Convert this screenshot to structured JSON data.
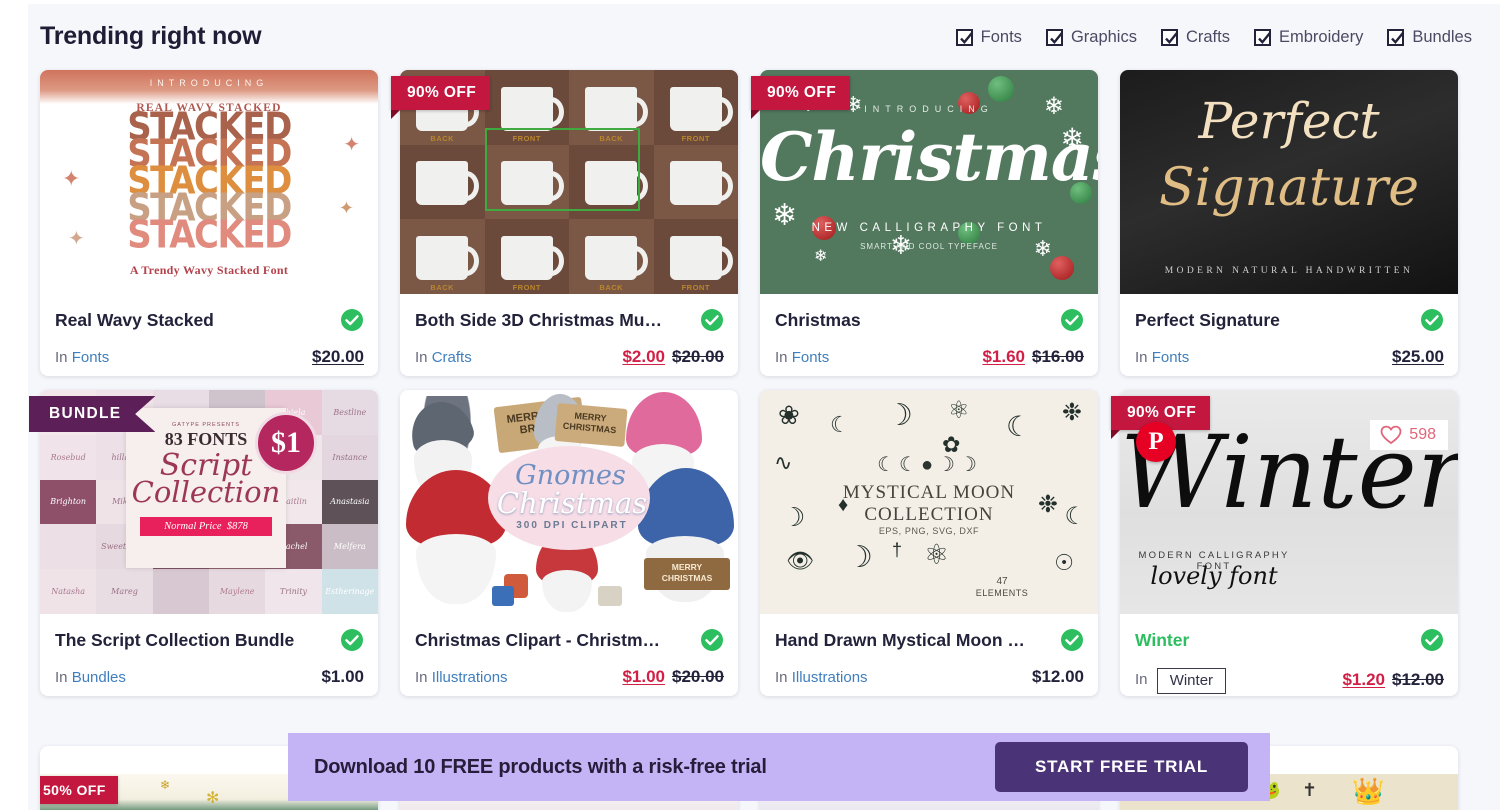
{
  "header": {
    "title": "Trending right now",
    "filters": [
      {
        "label": "Fonts",
        "checked": true
      },
      {
        "label": "Graphics",
        "checked": true
      },
      {
        "label": "Crafts",
        "checked": true
      },
      {
        "label": "Embroidery",
        "checked": true
      },
      {
        "label": "Bundles",
        "checked": true
      }
    ]
  },
  "colors": {
    "discount_badge": "#c3173f",
    "bundle_badge": "#5c1f57",
    "verified_green": "#2dbe60",
    "sale_price_red": "#d21f45",
    "category_link": "#3f7fbf",
    "banner_bg": "#c5b4f5",
    "banner_button": "#4b3377",
    "pinterest_red": "#e60023",
    "like_pink": "#e0657a"
  },
  "products": [
    {
      "title": "Real Wavy Stacked",
      "category_prefix": "In",
      "category": "Fonts",
      "price": "$20.00",
      "old_price": "",
      "badge": "",
      "verified": true,
      "art": {
        "intro": "INTRODUCING",
        "name": "REAL WAVY STACKED",
        "word": "STACKED",
        "tagline": "A Trendy Wavy Stacked Font"
      }
    },
    {
      "title": "Both Side 3D Christmas Mu…",
      "category_prefix": "In",
      "category": "Crafts",
      "price": "$2.00",
      "old_price": "$20.00",
      "badge": "90% OFF",
      "verified": true,
      "art": {
        "labels": [
          "BACK",
          "FRONT",
          "BACK",
          "FRONT",
          "BACK",
          "FRONT",
          "BACK",
          "FRONT"
        ]
      }
    },
    {
      "title": "Christmas",
      "category_prefix": "In",
      "category": "Fonts",
      "price": "$1.60",
      "old_price": "$16.00",
      "badge": "90% OFF",
      "verified": true,
      "art": {
        "intro": "INTRODUCING",
        "word": "Christmas",
        "sub": "NEW CALLIGRAPHY FONT",
        "sub2": "SMART AND COOL TYPEFACE"
      }
    },
    {
      "title": "Perfect Signature",
      "category_prefix": "In",
      "category": "Fonts",
      "price": "$25.00",
      "old_price": "",
      "badge": "",
      "verified": true,
      "art": {
        "line1": "Perfect",
        "line2": "Signature",
        "sub": "MODERN NATURAL HANDWRITTEN"
      }
    },
    {
      "title": "The Script Collection Bundle",
      "category_prefix": "In",
      "category": "Bundles",
      "price": "$1.00",
      "old_price": "",
      "badge": "BUNDLE",
      "verified": true,
      "art": {
        "presents": "GATYPE PRESENTS",
        "count": "83 FONTS",
        "line1": "Script",
        "line2": "Collection",
        "normal_label": "Normal Price",
        "normal_price": "$878",
        "dollar": "$1"
      }
    },
    {
      "title": "Christmas Clipart - Christm…",
      "category_prefix": "In",
      "category": "Illustrations",
      "price": "$1.00",
      "old_price": "$20.00",
      "badge": "",
      "verified": true,
      "art": {
        "line1": "Gnomes",
        "line2": "Christmas",
        "sub": "300 DPI CLIPART",
        "sign1": "MERRY AND BRIGHT",
        "sign2": "MERRY CHRISTMAS",
        "sign3": "MERRY CHRISTMAS"
      }
    },
    {
      "title": "Hand Drawn Mystical Moon …",
      "category_prefix": "In",
      "category": "Illustrations",
      "price": "$12.00",
      "old_price": "",
      "badge": "",
      "verified": true,
      "art": {
        "line1": "MYSTICAL MOON",
        "line2": "COLLECTION",
        "formats": "EPS, PNG, SVG, DXF",
        "elements_count": "47",
        "elements_label": "ELEMENTS"
      }
    },
    {
      "title": "Winter",
      "category_prefix": "In",
      "category": "Winter",
      "category_tooltip": "Winter",
      "price": "$1.20",
      "old_price": "$12.00",
      "badge": "90% OFF",
      "verified": true,
      "hovered": true,
      "pinterest_save": "P",
      "like_count": "598",
      "art": {
        "word": "Winter",
        "sub": "MODERN CALLIGRAPHY FONT",
        "sub2": "lovely font"
      }
    }
  ],
  "partial_row": [
    {
      "badge": "50% OFF"
    },
    {
      "badge": ""
    },
    {
      "badge": ""
    },
    {
      "badge": ""
    }
  ],
  "banner": {
    "text": "Download 10 FREE products with a risk-free trial",
    "button_label": "START FREE TRIAL"
  }
}
